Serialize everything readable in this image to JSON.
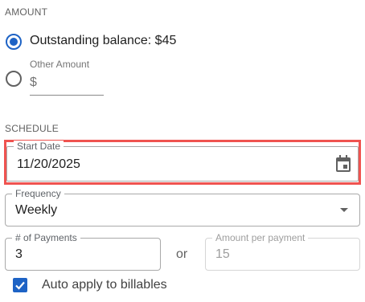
{
  "amount": {
    "section_label": "AMOUNT",
    "outstanding_label": "Outstanding balance: $45",
    "other_amount_label": "Other Amount",
    "currency_prefix": "$",
    "other_amount_value": ""
  },
  "schedule": {
    "section_label": "SCHEDULE",
    "start_date": {
      "label": "Start Date",
      "value": "11/20/2025"
    },
    "frequency": {
      "label": "Frequency",
      "value": "Weekly"
    },
    "num_payments": {
      "label": "# of Payments",
      "value": "3"
    },
    "or_text": "or",
    "amount_per_payment": {
      "label": "Amount per payment",
      "value": "15"
    },
    "auto_apply_label": "Auto apply to billables"
  },
  "colors": {
    "accent": "#1e63c5",
    "highlight": "#ef5350"
  }
}
